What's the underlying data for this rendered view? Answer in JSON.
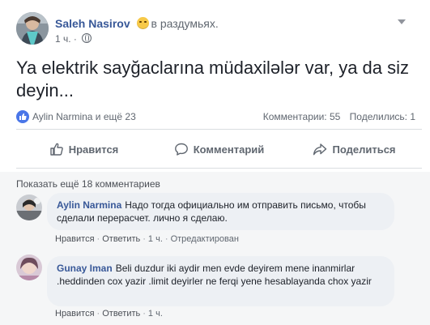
{
  "post": {
    "author": "Saleh Nasirov",
    "feeling": "в раздумьях.",
    "time": "1 ч.",
    "text": "Ya elektrik sayğaclarına müdaxilələr var, ya da siz deyin...",
    "reactions_label": "Aylin Narmina и ещё 23",
    "comments_count": "Комментарии: 55",
    "shares_count": "Поделились: 1"
  },
  "actions": {
    "like": "Нравится",
    "comment": "Комментарий",
    "share": "Поделиться"
  },
  "comments": {
    "show_more": "Показать ещё 18 комментариев",
    "items": [
      {
        "author": "Aylin Narmina",
        "text": "Надо тогда официально им отправить письмо, чтобы сделали перерасчет. лично я сделаю.",
        "like": "Нравится",
        "reply": "Ответить",
        "time": "1 ч.",
        "edited": "Отредактирован"
      },
      {
        "author": "Gunay Iman",
        "text": "Beli duzdur iki aydir men evde deyirem mene inanmirlar .heddinden cox yazir .limit deyirler ne ferqi yene hesablayanda chox yazir",
        "like": "Нравится",
        "reply": "Ответить",
        "time": "1 ч."
      }
    ]
  },
  "colors": {
    "link_blue": "#385898",
    "like_blue": "#4a76e8",
    "secondary_text": "#606770",
    "comment_bubble": "#edf0f4"
  },
  "icons": [
    "feeling-thinking-icon",
    "globe-icon",
    "caret-down-icon",
    "like-badge-icon",
    "like-icon",
    "comment-icon",
    "share-icon"
  ]
}
